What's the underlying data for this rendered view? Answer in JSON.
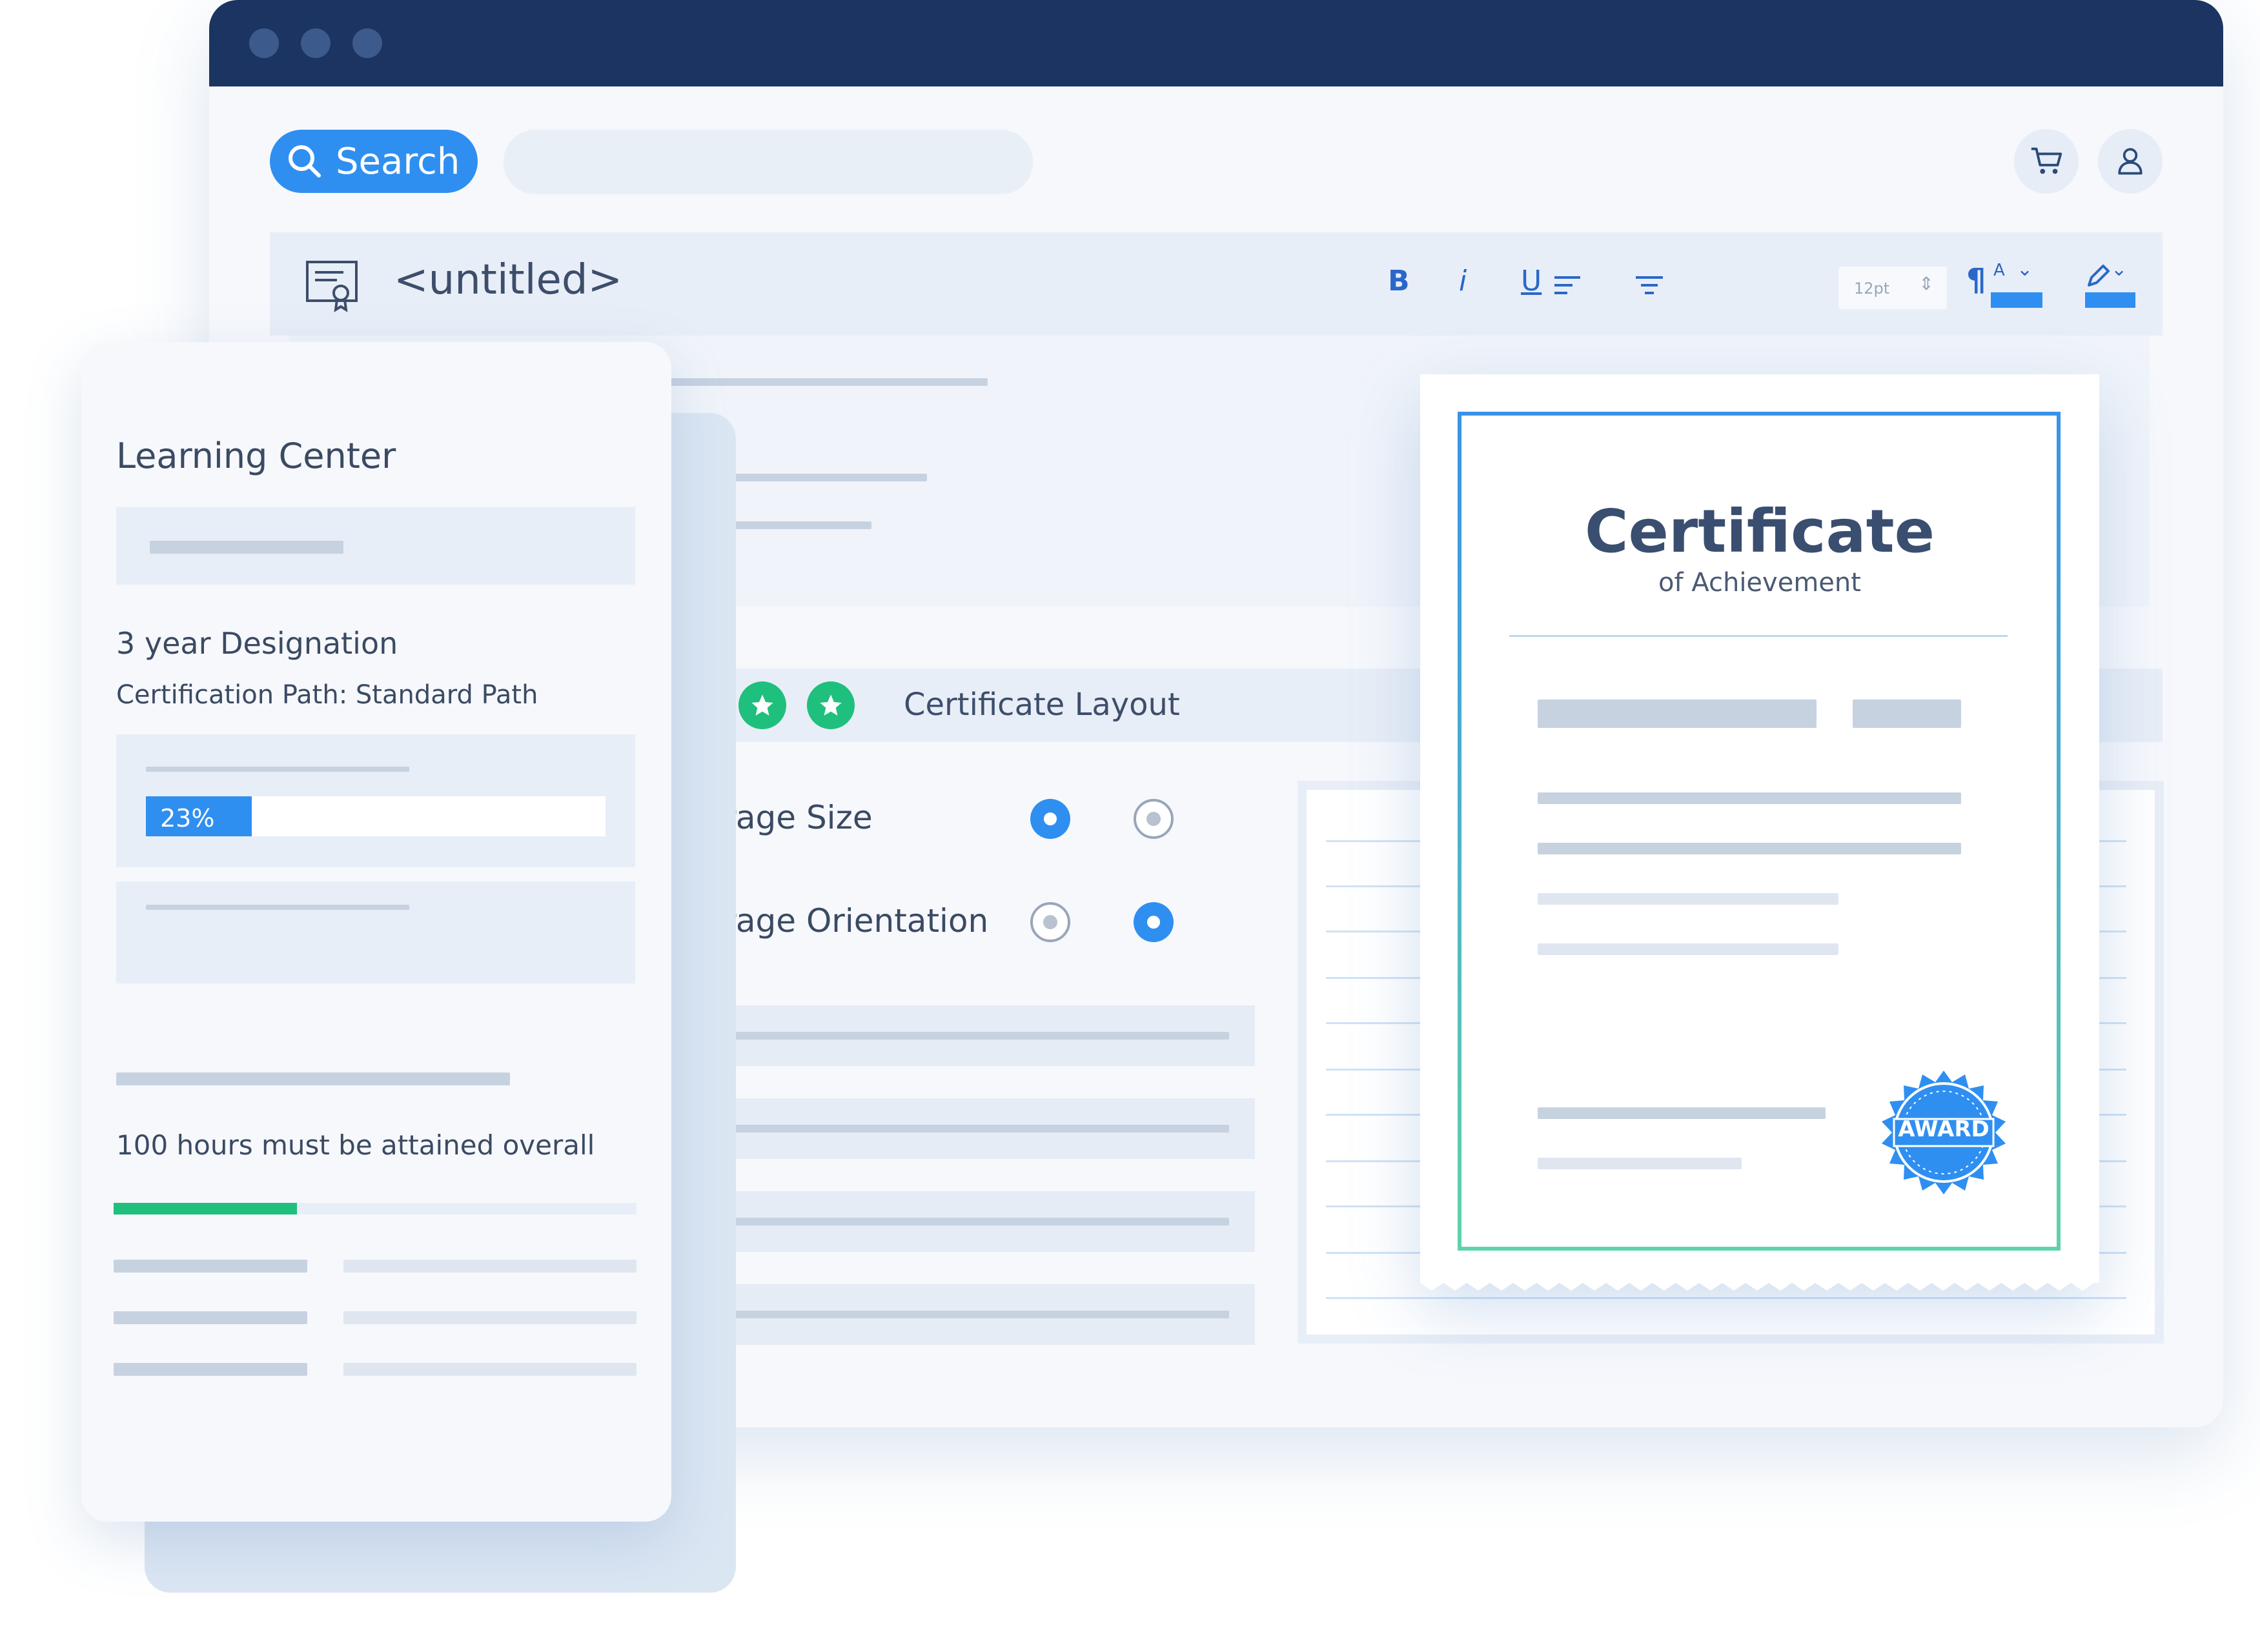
{
  "window": {
    "search": {
      "label": "Search",
      "placeholder": ""
    },
    "document": {
      "title": "<untitled>"
    },
    "toolbar": {
      "bold": "B",
      "italic": "i",
      "underline": "U",
      "font_size": "12pt",
      "font_color_label": "A"
    },
    "icons": [
      "search-icon",
      "cart-icon",
      "user-icon",
      "certificate-icon",
      "align-left-icon",
      "align-center-icon",
      "list-icon",
      "paragraph-icon",
      "pencil-icon",
      "chevron-down-icon",
      "star-icon",
      "award-seal-icon"
    ],
    "layout_section": {
      "title": "Certificate Layout",
      "options": [
        {
          "label": "Page Size"
        },
        {
          "label": "Page Orientation"
        }
      ]
    },
    "certificate": {
      "title": "Certificate",
      "subtitle": "of Achievement",
      "seal_text": "AWARD"
    }
  },
  "learning_center": {
    "title": "Learning Center",
    "designation": "3 year Designation",
    "path": "Certification Path: Standard Path",
    "progress_label": "23%",
    "progress": 0.23,
    "hours_text": "100 hours must be attained overall",
    "hours_progress": 0.35
  },
  "colors": {
    "titlebar": "#1b3461",
    "accent": "#2f8ff0",
    "success": "#1fbf7d",
    "background": "#f6f8fc"
  }
}
